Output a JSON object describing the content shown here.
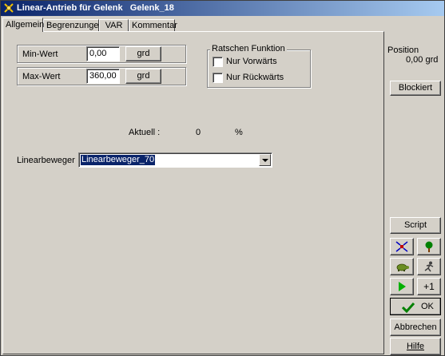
{
  "window": {
    "title": "Linear-Antrieb für Gelenk   Gelenk_18"
  },
  "tabs": [
    {
      "label": "Allgemein"
    },
    {
      "label": "Begrenzungen"
    },
    {
      "label": "VAR"
    },
    {
      "label": "Kommentar"
    }
  ],
  "limits": {
    "min_label": "Min-Wert",
    "min_value": "0,00",
    "max_label": "Max-Wert",
    "max_value": "360,00",
    "unit_button": "grd"
  },
  "ratchet": {
    "title": "Ratschen Funktion",
    "forward_label": "Nur Vorwärts",
    "backward_label": "Nur Rückwärts"
  },
  "status": {
    "current_label": "Aktuell :",
    "current_value": "0",
    "current_unit": "%"
  },
  "mover": {
    "label": "Linearbeweger",
    "selected": "Linearbeweger_70"
  },
  "side": {
    "position_label": "Position",
    "position_value": "0,00 grd",
    "blocked_button": "Blockiert",
    "script_button": "Script",
    "plus_one_button": "+1",
    "ok_button": "OK",
    "cancel_button": "Abbrechen",
    "help_button": "Hilfe"
  },
  "colors": {
    "face": "#d4d0c8",
    "title_start": "#0a246a",
    "title_end": "#a6caf0",
    "selection": "#0a246a",
    "play_green": "#00b000"
  }
}
